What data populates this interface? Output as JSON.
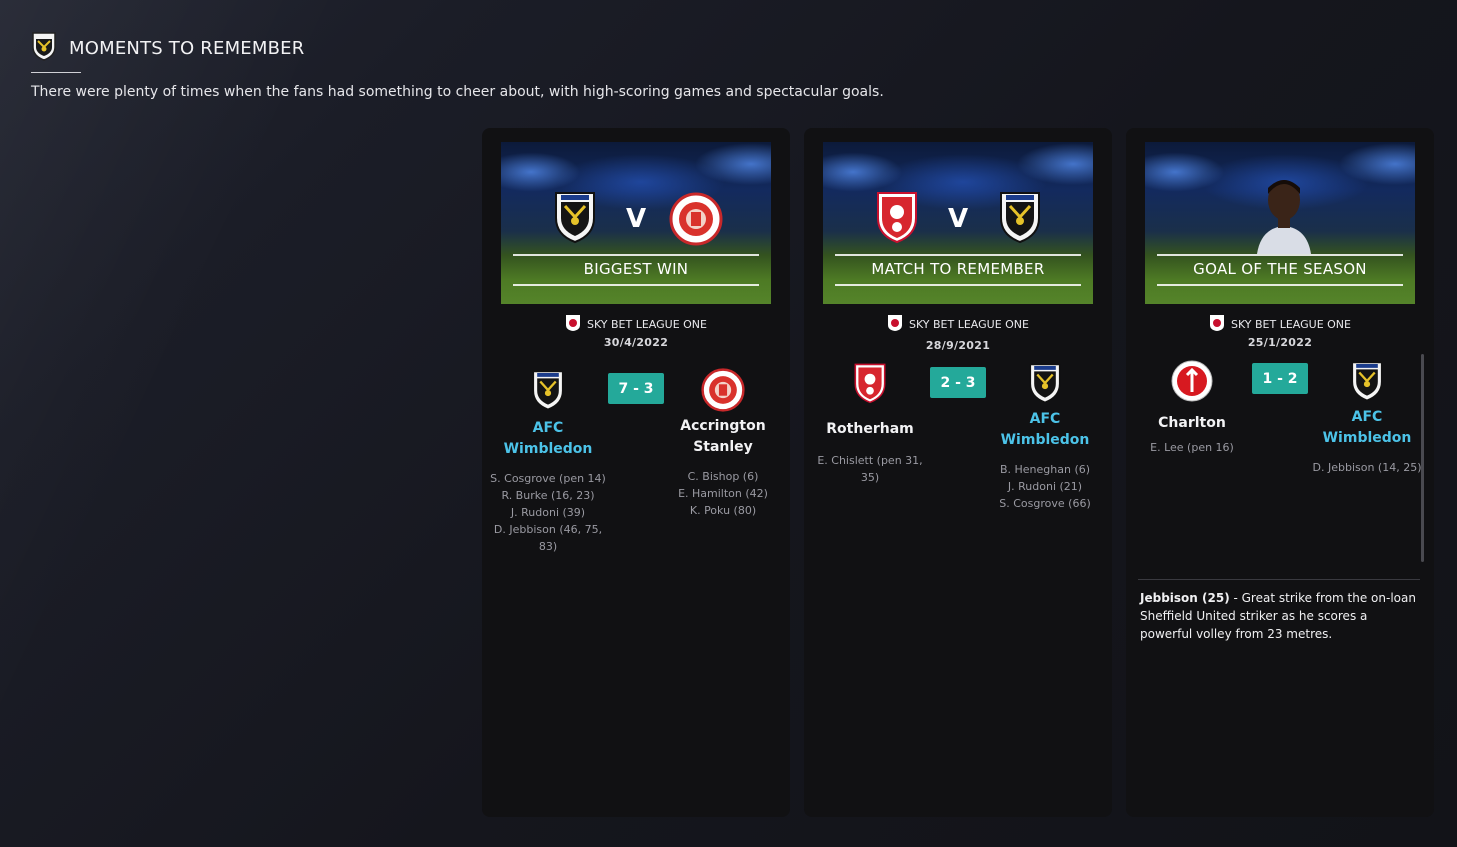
{
  "header": {
    "title": "MOMENTS TO REMEMBER",
    "description": "There were plenty of times when the fans had something to cheer about, with high-scoring games and spectacular goals."
  },
  "cards": [
    {
      "banner": "BIGGEST WIN",
      "competition": "SKY BET LEAGUE ONE",
      "date": "30/4/2022",
      "score": "7 - 3",
      "home": {
        "name_line1": "AFC",
        "name_line2": "Wimbledon",
        "scorers": [
          "S. Cosgrove (pen 14)",
          "R. Burke (16, 23)",
          "J. Rudoni (39)",
          "D. Jebbison (46, 75,",
          "83)"
        ]
      },
      "away": {
        "name_line1": "Accrington",
        "name_line2": "Stanley",
        "scorers": [
          "C. Bishop (6)",
          "E. Hamilton (42)",
          "K. Poku (80)"
        ]
      }
    },
    {
      "banner": "MATCH TO REMEMBER",
      "competition": "SKY BET LEAGUE ONE",
      "date": "28/9/2021",
      "score": "2 - 3",
      "home": {
        "name_line1": "Rotherham",
        "scorers": [
          "E. Chislett (pen 31,",
          "35)"
        ]
      },
      "away": {
        "name_line1": "AFC",
        "name_line2": "Wimbledon",
        "scorers": [
          "B. Heneghan (6)",
          "J. Rudoni (21)",
          "S. Cosgrove (66)"
        ]
      }
    },
    {
      "banner": "GOAL OF THE SEASON",
      "competition": "SKY BET LEAGUE ONE",
      "date": "25/1/2022",
      "score": "1 - 2",
      "home": {
        "name_line1": "Charlton",
        "scorers": [
          "E. Lee (pen 16)"
        ]
      },
      "away": {
        "name_line1": "AFC",
        "name_line2": "Wimbledon",
        "scorers": [
          "D. Jebbison (14, 25)"
        ]
      },
      "goal_title": "Jebbison (25)",
      "goal_text": " - Great strike from the on-loan Sheffield United striker as he scores a powerful volley from 23 metres."
    }
  ],
  "colors": {
    "accent_teal": "#24a99a",
    "team_highlight": "#4cc3e8"
  }
}
